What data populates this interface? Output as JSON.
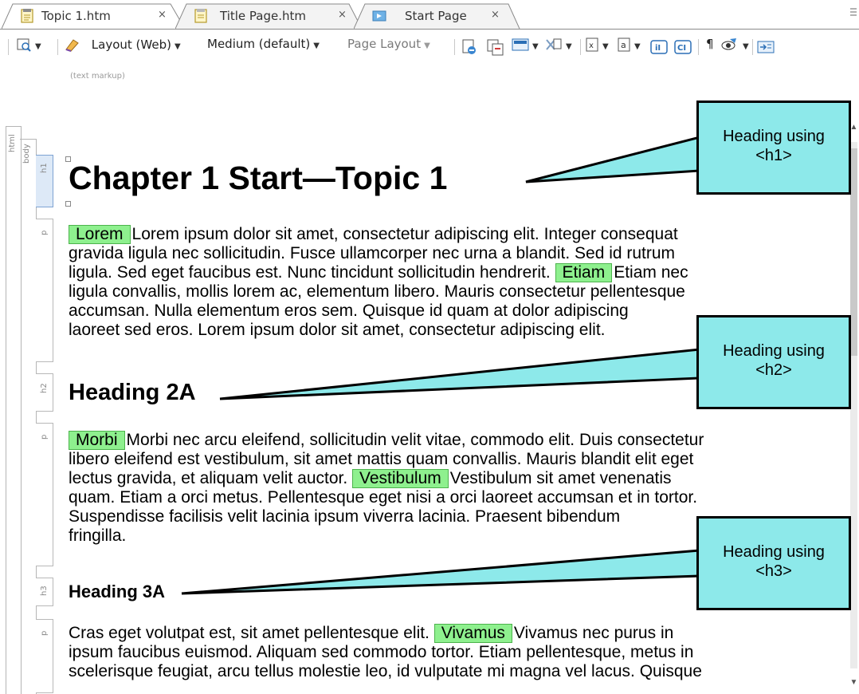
{
  "tabs": [
    {
      "label": "Topic 1.htm",
      "close": "×",
      "icon": "document-icon",
      "active": true
    },
    {
      "label": "Title Page.htm",
      "close": "×",
      "icon": "document-icon",
      "active": false
    },
    {
      "label": "Start Page",
      "close": "×",
      "icon": "start-page-icon",
      "active": false
    }
  ],
  "toolbar": {
    "layout_web": "Layout (Web)",
    "medium": "Medium (default)",
    "page_layout": "Page Layout",
    "hint": "(text markup)",
    "pilcrow": "¶"
  },
  "structure": {
    "html_label": "html",
    "body_label": "body",
    "blocks": [
      "h1",
      "p",
      "h2",
      "p",
      "h3",
      "p"
    ]
  },
  "document": {
    "h1": "Chapter 1 Start—Topic 1",
    "p1": {
      "marker": "Lorem",
      "lines": [
        "Lorem ipsum dolor sit amet, consectetur adipiscing elit. Integer consequat",
        "gravida ligula nec sollicitudin. Fusce ullamcorper nec urna a blandit. Sed id rutrum",
        "ligula. Sed eget faucibus est. Nunc tincidunt sollicitudin hendrerit. ",
        "ligula convallis, mollis lorem ac, elementum libero. Mauris consectetur pellentesque",
        "accumsan. Nulla elementum eros sem. Quisque id quam at dolor adipiscing",
        "laoreet sed eros. Lorem ipsum dolor sit amet, consectetur adipiscing elit."
      ],
      "inline_marker": "Etiam",
      "inline_after": "Etiam nec"
    },
    "h2": "Heading 2A",
    "p2": {
      "marker": "Morbi",
      "lines": [
        "Morbi nec arcu eleifend, sollicitudin velit vitae, commodo elit. Duis consectetur",
        "libero eleifend est vestibulum, sit amet mattis quam convallis. Mauris blandit elit eget",
        "lectus gravida, et aliquam velit auctor. ",
        "quam. Etiam a orci metus. Pellentesque eget nisi a orci laoreet accumsan et in tortor.",
        "Suspendisse facilisis velit lacinia ipsum viverra lacinia. Praesent bibendum",
        "fringilla."
      ],
      "inline_marker": "Vestibulum",
      "inline_after": "Vestibulum sit amet venenatis"
    },
    "h3": "Heading 3A",
    "p3": {
      "lines": [
        "Cras eget volutpat est, sit amet pellentesque elit. ",
        "ipsum faucibus euismod. Aliquam sed commodo tortor. Etiam pellentesque, metus in",
        "scelerisque feugiat, arcu tellus molestie leo, id vulputate mi magna vel lacus. Quisque"
      ],
      "inline_marker": "Vivamus",
      "inline_after": "Vivamus nec purus in"
    }
  },
  "callouts": [
    {
      "line1": "Heading using",
      "line2": "<h1>"
    },
    {
      "line1": "Heading using",
      "line2": "<h2>"
    },
    {
      "line1": "Heading using",
      "line2": "<h3>"
    }
  ],
  "colors": {
    "callout_fill": "#8de9ea",
    "marker_fill": "#8ef08e",
    "active_block": "#dde9f7"
  }
}
